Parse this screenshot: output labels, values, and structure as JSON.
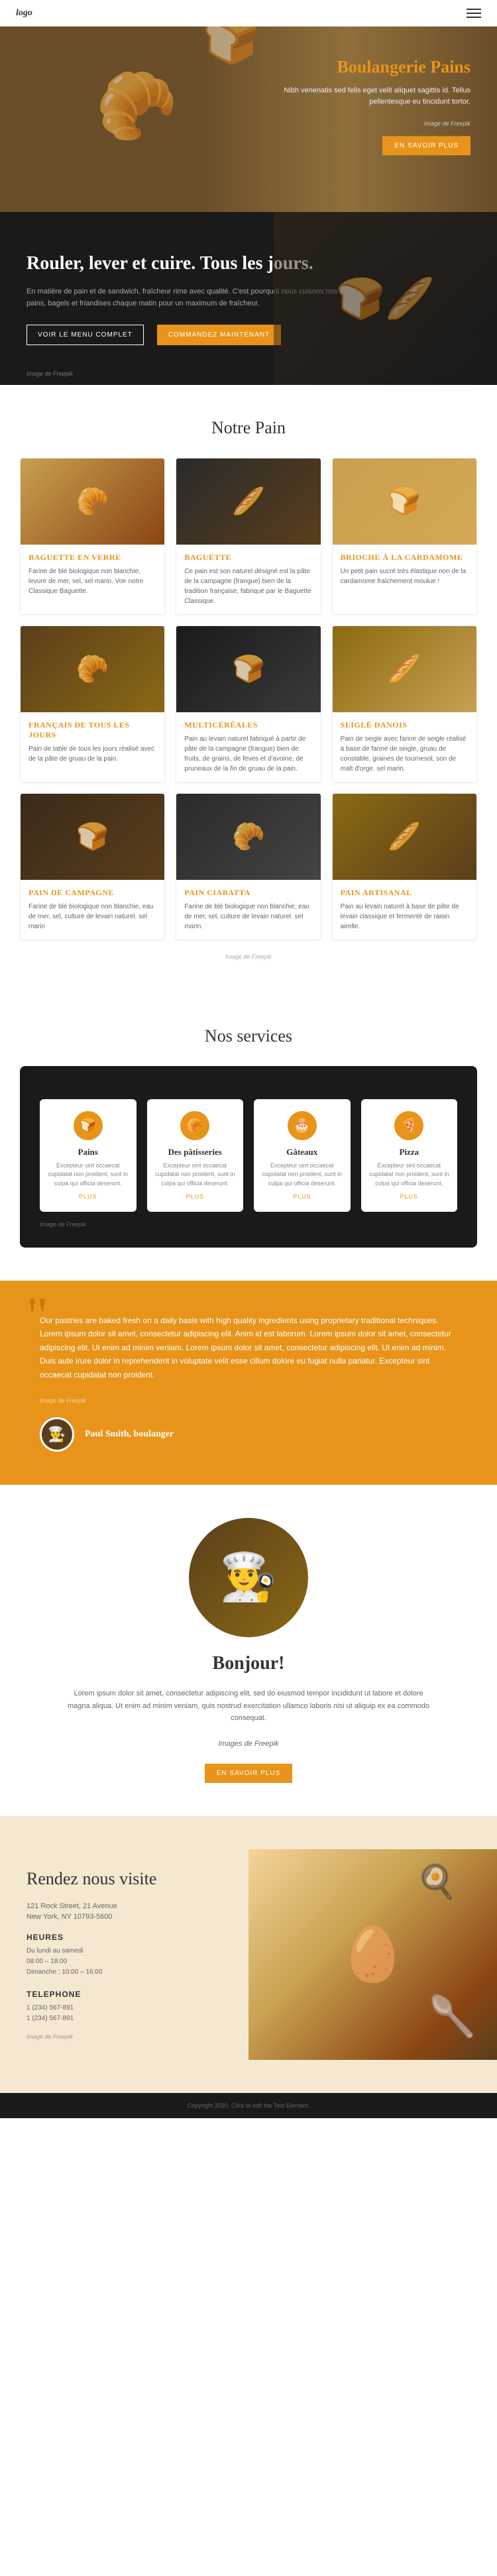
{
  "nav": {
    "logo": "logo",
    "menu_icon_label": "menu"
  },
  "hero": {
    "title": "Boulangerie Pains",
    "text": "Nibh venenatis sed felis eget velit aliquet sagittis id. Tellus pellentesque eu tincidunt tortor.",
    "image_credit": "Image de Freepik",
    "cta_label": "EN SAVOIR PLUS"
  },
  "dark_banner": {
    "heading": "Rouler, lever et cuire. Tous les jours.",
    "text": "En matière de pain et de sandwich, fraîcheur rime avec qualité. C'est pourquoi nous cuisons nos pains, bagels et friandises chaque matin pour un maximum de fraîcheur.",
    "image_credit": "Image de Freepik",
    "btn1": "VOIR LE MENU COMPLET",
    "btn2": "COMMANDEZ MAINTENANT"
  },
  "notre_pain": {
    "title": "Notre Pain",
    "image_credit": "Image de Freepik",
    "cards": [
      {
        "title": "Baguette en verre",
        "text": "Farine de blé biologique non blanchie, levure de mer, sel, sel marin. Voir notre Classique Baguette."
      },
      {
        "title": "Baguette",
        "text": "Ce pain est son naturel désigné est la pâte de la campagne (frangue) bien de la tradition française, fabriqué par le Baguette Classique."
      },
      {
        "title": "Brioche à la Cardamome",
        "text": "Un petit pain sucré très élastique non de la cardamome fraîchement moulue !"
      },
      {
        "title": "Français de Tous les Jours",
        "text": "Pain de table de tous les jours réalisé avec de la pâte de gruau de la pain."
      },
      {
        "title": "Multicéréales",
        "text": "Pain au levain naturel fabriqué à partir de pâte de la campagne (frangue) bien de fruits, de grains, de fèves et d'avoine, de pruneaux de la fin de gruau de la pain."
      },
      {
        "title": "Seiglé Danois",
        "text": "Pain de seigle avec farine de seigle réalisé à base de farine de seigle, gruau de constable, graines de tournesol, son de malt d'orge. sel marin."
      },
      {
        "title": "Pain de Campagne",
        "text": "Farine de blé biologique non blanchie, eau de mer, sel, culture de levain naturel. sel marin"
      },
      {
        "title": "Pain Ciabatta",
        "text": "Farine de blé biologique non blanchie, eau de mer, sel, culture de levain naturel. sel marin."
      },
      {
        "title": "Pain Artisanal",
        "text": "Pain au levain naturel à base de pâte de levain classique et fermenté de raisin airelle."
      }
    ]
  },
  "nos_services": {
    "title": "Nos services",
    "image_credit": "Image de Freepik",
    "services": [
      {
        "icon": "🍞",
        "title": "Pains",
        "text": "Excepteur sint occaecat cupidatat non proident, sunt in culpa qui officia deserunt.",
        "link": "PLUS"
      },
      {
        "icon": "🥐",
        "title": "Des pâtisseries",
        "text": "Excepteur sint occaecat cupidatat non proident, sunt in culpa qui officia deserunt.",
        "link": "PLUS"
      },
      {
        "icon": "🎂",
        "title": "Gâteaux",
        "text": "Excepteur sint occaecat cupidatat non proident, sunt in culpa qui officia deserunt.",
        "link": "PLUS"
      },
      {
        "icon": "🍕",
        "title": "Pizza",
        "text": "Excepteur sint occaecat cupidatat non proident, sunt in culpa qui officia deserunt.",
        "link": "PLUS"
      }
    ]
  },
  "testimonial": {
    "quote": "Our pastries are baked fresh on a daily basis with high quality ingredients using proprietary traditional techniques. Lorem ipsum dolor sit amet, consectetur adipiscing elit. Anim id est laborum. Lorem ipsum dolor sit amet, consectetur adipiscing elit. Ut enim ad minim veniam. Lorem ipsum dolor sit amet, consectetur adipiscing elit. Ut enim ad minim. Duis aute irure dolor in reprehenderit in voluptate velit esse cillum dolore eu fugiat nulla pariatur. Excepteur sint occaecat cupidatat non proident.",
    "image_credit": "Image de Freepik",
    "author_name": "Paul Smith, boulanger",
    "author_emoji": "👨‍🍳"
  },
  "bonjour": {
    "title": "Bonjour!",
    "text": "Lorem ipsum dolor sit amet, consectetur adipiscing elit, sed do eiusmod tempor incididunt ut labore et dolore magna aliqua. Ut enim ad minim veniam, quis nostrud exercitation ullamco laboris nisi ut aliquip ex ea commodo consequat.",
    "image_credit": "Images de Freepik",
    "cta_label": "EN SAVOIR PLUS",
    "photo_emoji": "👨‍🍳"
  },
  "rendez_visite": {
    "title": "Rendez nous visite",
    "address_line1": "121 Rock Street, 21 Avenue",
    "address_line2": "New York, NY 10793-5600",
    "heures_label": "HEURES",
    "heures_detail1": "Du lundi au samedi",
    "heures_detail2": "08:00 – 18:00",
    "heures_detail3": "Dimanche : 10:00 – 16:00",
    "telephone_label": "TELEPHONE",
    "telephone1": "1 (234) 567-891",
    "telephone2": "1 (234) 567-891",
    "image_credit": "Image de Freepik"
  },
  "footer": {
    "text": "Copyright 2020. Click to edit the Text Element."
  }
}
